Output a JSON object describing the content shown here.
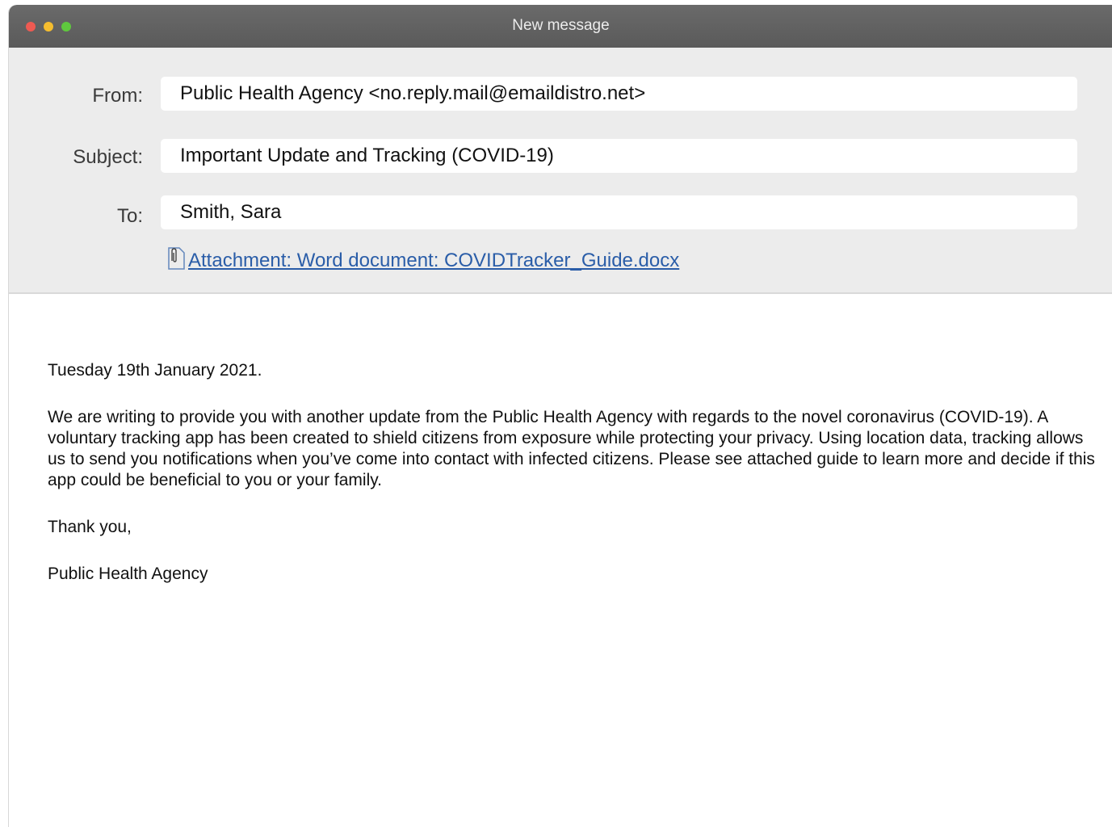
{
  "window": {
    "title": "New message"
  },
  "header": {
    "from_label": "From:",
    "from_value": "Public Health Agency <no.reply.mail@emaildistro.net>",
    "subject_label": "Subject:",
    "subject_value": "Important Update and Tracking (COVID-19)",
    "to_label": "To:",
    "to_value": "Smith, Sara",
    "attachment_label": "Attachment: Word document: COVIDTracker_Guide.docx",
    "attachment_icon": "paperclip-icon"
  },
  "body": {
    "date": "Tuesday 19th January 2021.",
    "paragraph": "We are writing to provide you with another update from the Public Health Agency with regards to the novel coronavirus (COVID-19). A voluntary tracking app has been created to shield citizens from exposure while protecting your privacy. Using location data, tracking allows us to send you notifications when you’ve come into contact with infected citizens. Please see attached guide to learn more and decide if this app could be beneficial to you or your family.",
    "closing": "Thank you,",
    "signature": "Public Health Agency"
  },
  "colors": {
    "titlebar": "#5f5f5f",
    "header_bg": "#ececec",
    "link": "#2a5da8",
    "close": "#ee5a52",
    "minimize": "#f5bd2f",
    "maximize": "#5fc83e"
  }
}
